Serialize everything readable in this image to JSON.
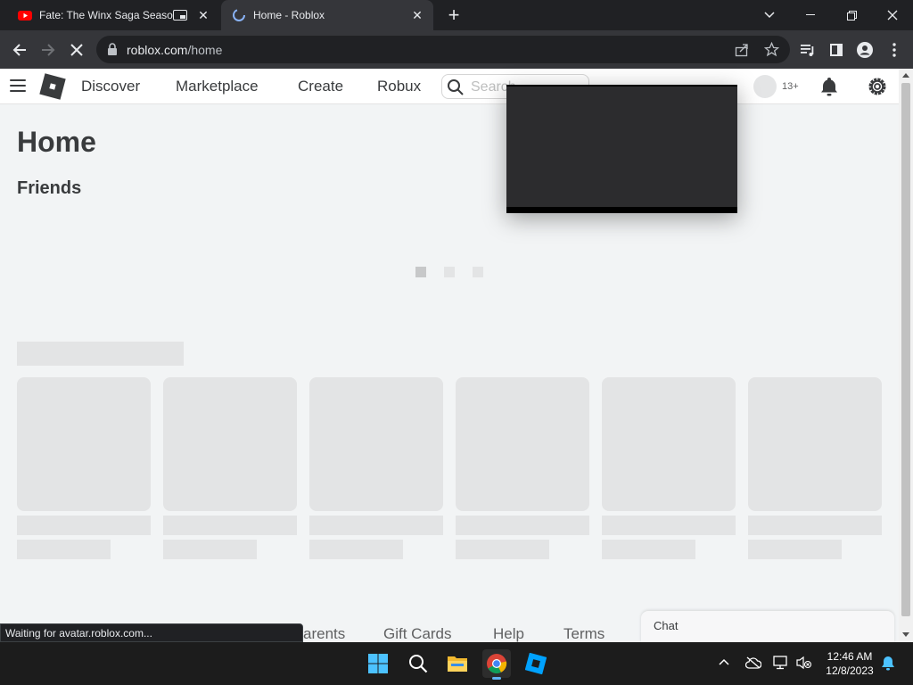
{
  "browser": {
    "tabs": [
      {
        "title": "Fate: The Winx Saga Season",
        "favicon": "youtube-icon",
        "active": false
      },
      {
        "title": "Home - Roblox",
        "favicon": "roblox-icon",
        "active": true
      }
    ],
    "url_host": "roblox.com",
    "url_path": "/home",
    "status_text": "Waiting for avatar.roblox.com..."
  },
  "header": {
    "nav": [
      "Discover",
      "Marketplace",
      "Create",
      "Robux"
    ],
    "search_placeholder": "Search",
    "age_badge": "13+"
  },
  "main": {
    "title": "Home",
    "friends_label": "Friends"
  },
  "footer": {
    "links": [
      "Parents",
      "Gift Cards",
      "Help",
      "Terms"
    ]
  },
  "chat": {
    "label": "Chat"
  },
  "taskbar": {
    "apps": [
      "windows-start-icon",
      "search-icon",
      "file-explorer-icon",
      "chrome-icon",
      "roblox-studio-icon"
    ],
    "time": "12:46 AM",
    "date": "12/8/2023"
  },
  "colors": {
    "page_bg": "#f2f4f5",
    "skeleton": "#e3e4e5",
    "text": "#393b3d",
    "chrome_dark": "#202124"
  }
}
